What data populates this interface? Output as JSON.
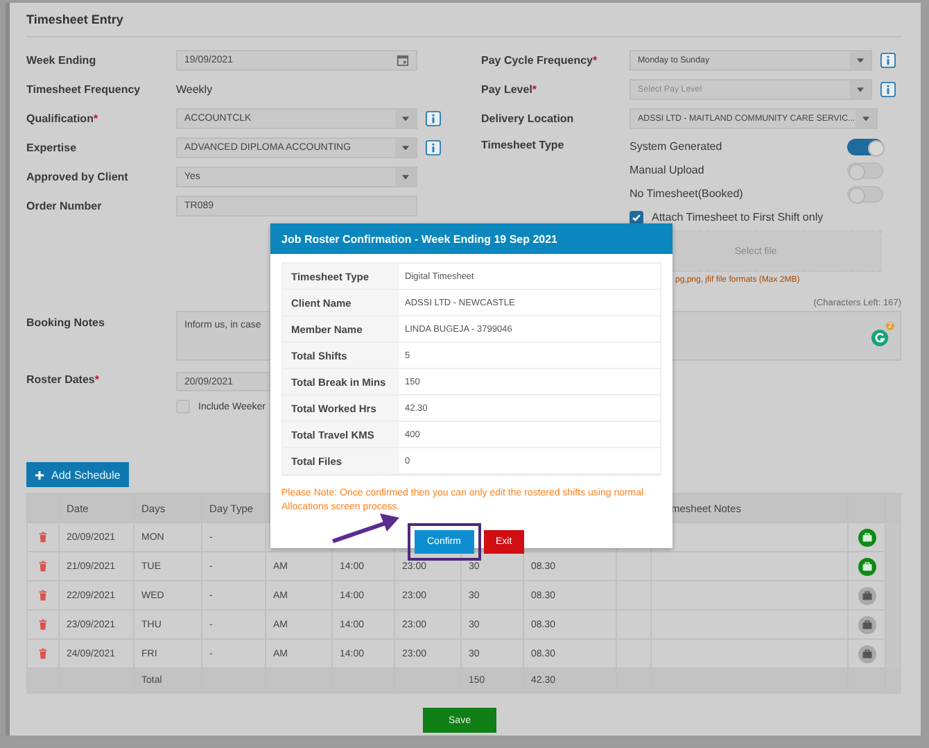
{
  "panel": {
    "title": "Timesheet Entry"
  },
  "left_fields": [
    {
      "label": "Week Ending",
      "kind": "date",
      "value": "19/09/2021",
      "info": false
    },
    {
      "label": "Timesheet Frequency",
      "kind": "text",
      "value": "Weekly",
      "info": false
    },
    {
      "label": "Qualification",
      "required_mark": "*",
      "kind": "select",
      "value": "ACCOUNTCLK",
      "info": true
    },
    {
      "label": "Expertise",
      "kind": "select",
      "value": "ADVANCED DIPLOMA ACCOUNTING",
      "info": true
    },
    {
      "label": "Approved by Client",
      "kind": "select",
      "value": "Yes",
      "info": false
    },
    {
      "label": "Order Number",
      "kind": "input",
      "value": "TR089",
      "info": false
    }
  ],
  "right_fields": [
    {
      "label": "Pay Cycle Frequency",
      "required_mark": "*",
      "kind": "select",
      "value": "Monday to Sunday",
      "info": true
    },
    {
      "label": "Pay Level",
      "required_mark": "*",
      "kind": "select",
      "placeholder": "Select Pay Level",
      "info": true
    },
    {
      "label": "Delivery Location",
      "kind": "select",
      "value": "ADSSI LTD - MAITLAND COMMUNITY CARE SERVIC...",
      "info": false
    }
  ],
  "timesheet_type": {
    "label": "Timesheet Type",
    "options": [
      {
        "label": "System Generated",
        "on": true
      },
      {
        "label": "Manual Upload",
        "on": false
      },
      {
        "label": "No Timesheet(Booked)",
        "on": false
      }
    ]
  },
  "attach_option": {
    "label": "Attach Timesheet to First Shift only",
    "checked": true
  },
  "upload": {
    "button": "Select file",
    "hint": "pg,png, jfif file formats (Max 2MB)"
  },
  "booking_notes": {
    "label": "Booking Notes",
    "value": "Inform us, in case",
    "counter": "(Characters Left: 167)",
    "grammar_badge": "2"
  },
  "roster_dates": {
    "label": "Roster Dates",
    "required_mark": "*",
    "value": "20/09/2021",
    "weekend_option": {
      "label": "Include Weeker",
      "checked": false
    }
  },
  "add_schedule_button": "Add Schedule",
  "table": {
    "header": {
      "date": "Date",
      "days": "Days",
      "day_type": "Day Type",
      "notes": "mesheet Notes"
    },
    "rows": [
      {
        "date": "20/09/2021",
        "day": "MON",
        "day_type": "-",
        "attached": true
      },
      {
        "date": "21/09/2021",
        "day": "TUE",
        "day_type": "-",
        "cells": [
          "AM",
          "14:00",
          "23:00",
          "30",
          "08.30"
        ],
        "attached": true
      },
      {
        "date": "22/09/2021",
        "day": "WED",
        "day_type": "-",
        "cells": [
          "AM",
          "14:00",
          "23:00",
          "30",
          "08.30"
        ],
        "attached": false
      },
      {
        "date": "23/09/2021",
        "day": "THU",
        "day_type": "-",
        "cells": [
          "AM",
          "14:00",
          "23:00",
          "30",
          "08.30"
        ],
        "attached": false
      },
      {
        "date": "24/09/2021",
        "day": "FRI",
        "day_type": "-",
        "cells": [
          "AM",
          "14:00",
          "23:00",
          "30",
          "08.30"
        ],
        "attached": false
      }
    ],
    "total": {
      "label": "Total",
      "break": "150",
      "worked": "42.30"
    }
  },
  "save_button": "Save",
  "modal": {
    "title": "Job Roster Confirmation - Week Ending 19 Sep 2021",
    "rows": [
      {
        "label": "Timesheet Type",
        "value": "Digital Timesheet"
      },
      {
        "label": "Client Name",
        "value": "ADSSI LTD - NEWCASTLE"
      },
      {
        "label": "Member Name",
        "value": "LINDA BUGEJA - 3799046"
      },
      {
        "label": "Total Shifts",
        "value": "5"
      },
      {
        "label": "Total Break in Mins",
        "value": "150"
      },
      {
        "label": "Total Worked Hrs",
        "value": "42.30"
      },
      {
        "label": "Total Travel KMS",
        "value": "400"
      },
      {
        "label": "Total Files",
        "value": "0"
      }
    ],
    "note": "Please Note: Once confirmed then you can only edit the rostered shifts using normal Allocations screen process.",
    "buttons": [
      {
        "label": "Confirm",
        "kind": "primary",
        "highlighted": true
      },
      {
        "label": "Exit",
        "kind": "danger",
        "highlighted": false
      }
    ]
  }
}
